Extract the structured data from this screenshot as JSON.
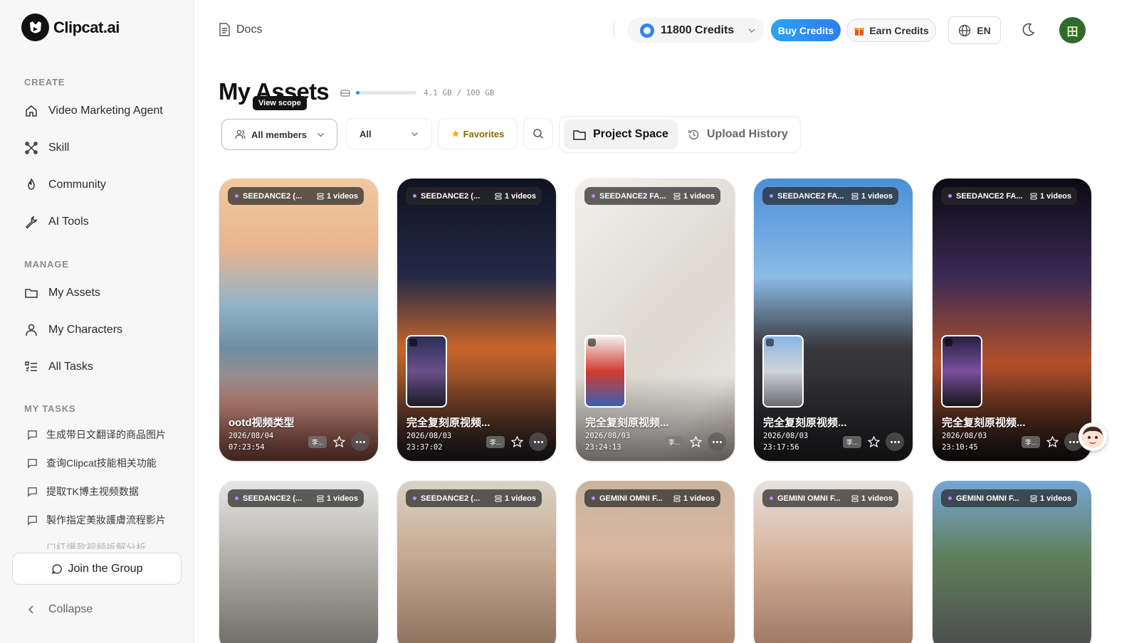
{
  "app": {
    "name": "Clipcat.ai"
  },
  "sidebar": {
    "create_label": "CREATE",
    "create_items": [
      {
        "label": "Video Marketing Agent",
        "icon": "home-icon"
      },
      {
        "label": "Skill",
        "icon": "skill-icon"
      },
      {
        "label": "Community",
        "icon": "flame-icon"
      },
      {
        "label": "AI Tools",
        "icon": "wrench-icon"
      }
    ],
    "manage_label": "MANAGE",
    "manage_items": [
      {
        "label": "My Assets",
        "icon": "folder-icon"
      },
      {
        "label": "My Characters",
        "icon": "user-icon"
      },
      {
        "label": "All Tasks",
        "icon": "tasks-icon"
      }
    ],
    "tasks_label": "MY TASKS",
    "tasks": [
      "生成带日文翻译的商品图片",
      "查询Clipcat技能相关功能",
      "提取TK博主视频数据",
      "製作指定美妝護膚流程影片",
      "口红爆款视频拆解分析"
    ],
    "join_label": "Join the Group",
    "collapse_label": "Collapse"
  },
  "header": {
    "docs_label": "Docs",
    "credits_label": "11800 Credits",
    "buy_label": "Buy Credits",
    "earn_label": "Earn Credits",
    "lang_label": "EN",
    "avatar_initial": "田"
  },
  "page": {
    "title": "My Assets",
    "storage_text": "4.1 GB / 100 GB",
    "storage_used_fraction": 0.041,
    "tooltip": "View scope",
    "filter_members": "All members",
    "filter_type": "All",
    "filter_favorites": "Favorites",
    "tab_project": "Project Space",
    "tab_history": "Upload History"
  },
  "colors": {
    "accent": "#2f86f0",
    "avatar_bg": "#2f6b2c"
  },
  "cards": [
    {
      "badge": "SEEDANCE2 (...",
      "count": "1 videos",
      "title": "ootd视频类型",
      "date": "2026/08/04",
      "time": "07:23:54",
      "owner": "李..."
    },
    {
      "badge": "SEEDANCE2 (...",
      "count": "1 videos",
      "title": "完全复刻原视频...",
      "date": "2026/08/03",
      "time": "23:37:02",
      "owner": "李..."
    },
    {
      "badge": "SEEDANCE2 FA...",
      "count": "1 videos",
      "title": "完全复刻原视频...",
      "date": "2026/08/03",
      "time": "23:24:13",
      "owner": "李..."
    },
    {
      "badge": "SEEDANCE2 FA...",
      "count": "1 videos",
      "title": "完全复刻原视频...",
      "date": "2026/08/03",
      "time": "23:17:56",
      "owner": "李..."
    },
    {
      "badge": "SEEDANCE2 FA...",
      "count": "1 videos",
      "title": "完全复刻原视频...",
      "date": "2026/08/03",
      "time": "23:10:45",
      "owner": "李..."
    },
    {
      "badge": "SEEDANCE2 (...",
      "count": "1 videos"
    },
    {
      "badge": "SEEDANCE2 (...",
      "count": "1 videos"
    },
    {
      "badge": "GEMINI OMNI F...",
      "count": "1 videos"
    },
    {
      "badge": "GEMINI OMNI F...",
      "count": "1 videos"
    },
    {
      "badge": "GEMINI OMNI F...",
      "count": "1 videos"
    }
  ]
}
